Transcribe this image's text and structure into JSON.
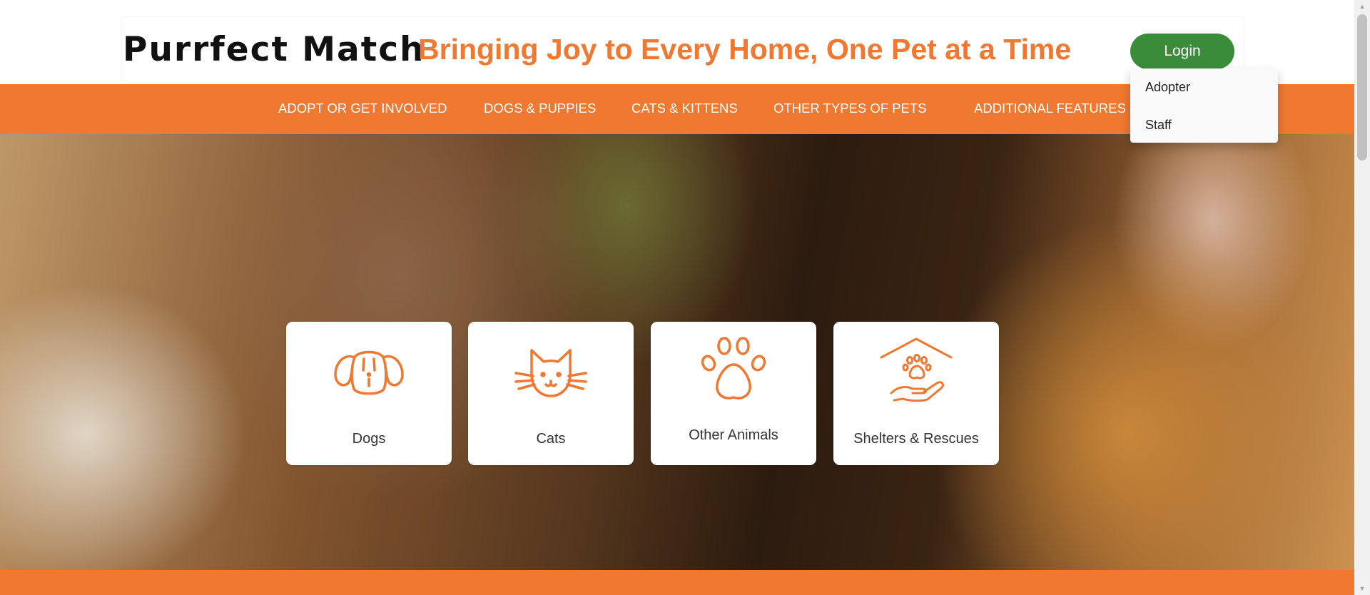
{
  "header": {
    "logo": "Purrfect Match",
    "tagline": "Bringing Joy to Every Home, One Pet at a Time",
    "login_label": "Login"
  },
  "login_menu": {
    "items": [
      "Adopter",
      "Staff"
    ]
  },
  "nav": {
    "items": [
      "ADOPT OR GET INVOLVED",
      "DOGS & PUPPIES",
      "CATS & KITTENS",
      "OTHER TYPES OF PETS",
      "ADDITIONAL FEATURES"
    ]
  },
  "categories": [
    {
      "label": "Dogs",
      "icon": "dog-icon"
    },
    {
      "label": "Cats",
      "icon": "cat-icon"
    },
    {
      "label": "Other Animals",
      "icon": "paw-icon"
    },
    {
      "label": "Shelters & Rescues",
      "icon": "shelter-icon"
    }
  ],
  "colors": {
    "accent": "#f07830",
    "login_button": "#3a8c3a",
    "nav_text": "#ffffff"
  }
}
